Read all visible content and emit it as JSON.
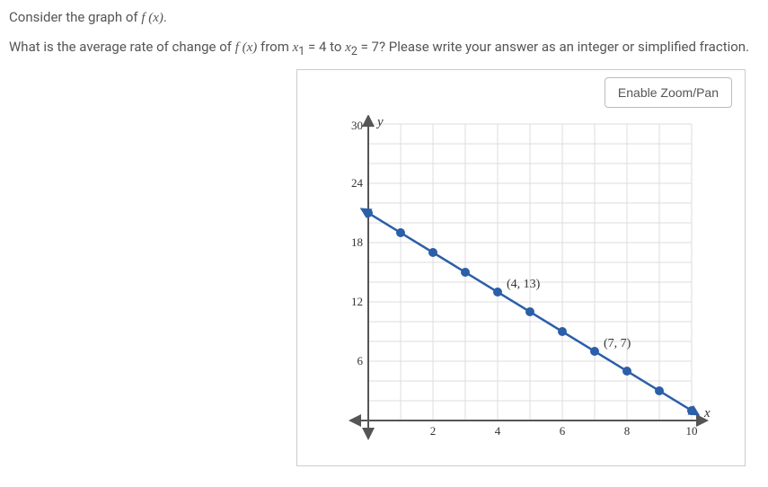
{
  "intro_prefix": "Consider the graph of ",
  "intro_fn": "f (x)",
  "intro_suffix": ".",
  "q_prefix": "What is the average rate of change of ",
  "q_fn": "f (x)",
  "q_mid1": " from ",
  "q_x1": "x",
  "q_sub1": "1",
  "q_eq1": " = 4",
  "q_mid2": " to ",
  "q_x2": "x",
  "q_sub2": "2",
  "q_eq2": " = 7",
  "q_suffix": "? Please write your answer as an integer or simplified fraction.",
  "zoom_label": "Enable Zoom/Pan",
  "axis_y_label": "y",
  "axis_x_label": "x",
  "y_ticks": {
    "t30": "30",
    "t24": "24",
    "t18": "18",
    "t12": "12",
    "t6": "6"
  },
  "x_ticks": {
    "t2": "2",
    "t4": "4",
    "t6": "6",
    "t8": "8",
    "t10": "10"
  },
  "annot1": "(4, 13)",
  "annot2": "(7, 7)",
  "chart_data": {
    "type": "line",
    "title": "",
    "xlabel": "x",
    "ylabel": "y",
    "xlim": [
      0,
      10
    ],
    "ylim": [
      0,
      30
    ],
    "series": [
      {
        "name": "f(x)",
        "points": [
          {
            "x": 0,
            "y": 21
          },
          {
            "x": 1,
            "y": 19
          },
          {
            "x": 2,
            "y": 17
          },
          {
            "x": 3,
            "y": 15
          },
          {
            "x": 4,
            "y": 13
          },
          {
            "x": 5,
            "y": 11
          },
          {
            "x": 6,
            "y": 9
          },
          {
            "x": 7,
            "y": 7
          },
          {
            "x": 8,
            "y": 5
          },
          {
            "x": 9,
            "y": 3
          },
          {
            "x": 10,
            "y": 1
          }
        ]
      }
    ],
    "annotations": [
      {
        "x": 4,
        "y": 13,
        "text": "(4, 13)"
      },
      {
        "x": 7,
        "y": 7,
        "text": "(7, 7)"
      }
    ]
  }
}
